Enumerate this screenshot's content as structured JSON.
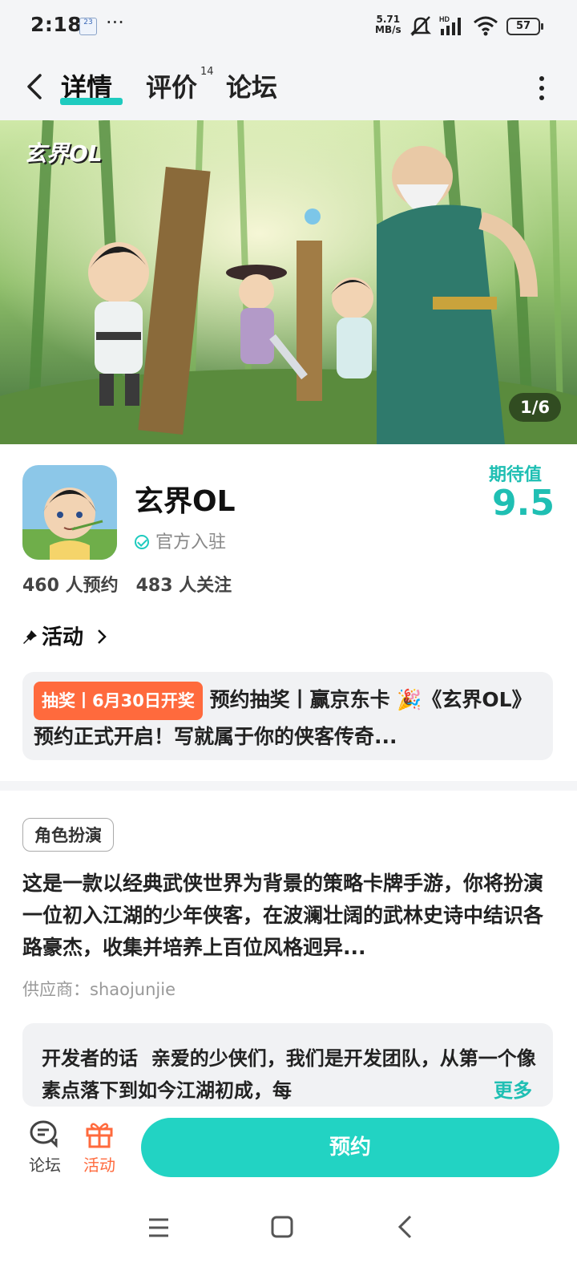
{
  "status_bar": {
    "time": "2:18",
    "calendar_day": "23",
    "overflow": "···",
    "net_speed_value": "5.71",
    "net_speed_unit": "MB/s",
    "signal_label": "HD",
    "battery": "57"
  },
  "nav": {
    "tabs": [
      {
        "label": "详情",
        "active": true
      },
      {
        "label": "评价",
        "active": false
      },
      {
        "label": "论坛",
        "active": false
      }
    ],
    "review_count": "14"
  },
  "banner": {
    "logo_text": "玄界OL",
    "counter": "1/6"
  },
  "game": {
    "name": "玄界OL",
    "official_label": "官方入驻",
    "expect_label": "期待值",
    "expect_value": "9.5",
    "reservations": "460 人预约",
    "followers": "483 人关注"
  },
  "activity": {
    "heading": "活动",
    "tag": "抽奖丨6月30日开奖",
    "text": "预约抽奖丨赢京东卡 🎉《玄界OL》预约正式开启！写就属于你的侠客传奇..."
  },
  "description": {
    "genre": "角色扮演",
    "text": "这是一款以经典武侠世界为背景的策略卡牌手游，你将扮演一位初入江湖的少年侠客，在波澜壮阔的武林史诗中结识各路豪杰，收集并培养上百位风格迥异...",
    "supplier": "供应商：shaojunjie"
  },
  "developer": {
    "title": "开发者的话",
    "text": "亲爱的少侠们，我们是开发团队，从第一个像素点落下到如今江湖初成，每",
    "more": "更多"
  },
  "action_bar": {
    "forum_label": "论坛",
    "activity_label": "活动",
    "reserve_label": "预约"
  },
  "colors": {
    "accent": "#1fcbbf",
    "orange": "#ff6a3d"
  }
}
